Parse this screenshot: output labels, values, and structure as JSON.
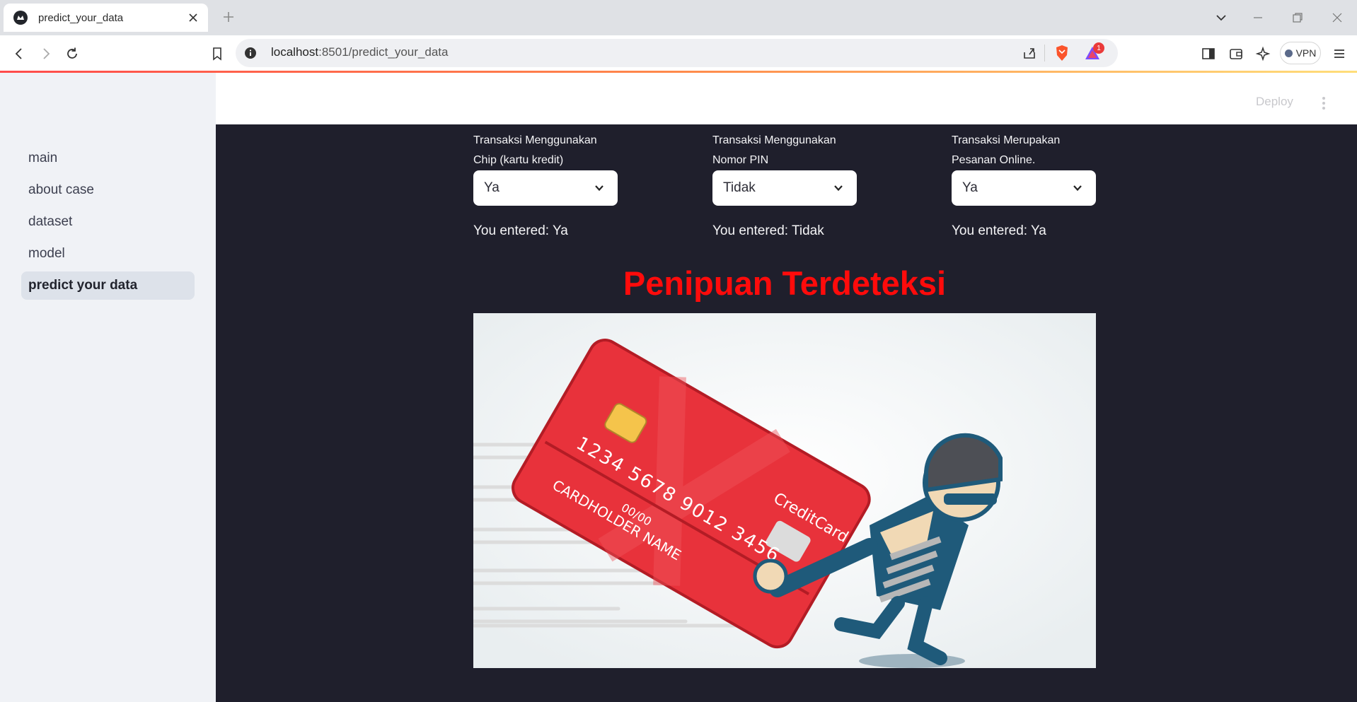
{
  "browser": {
    "tab_title": "predict_your_data",
    "url_host": "localhost",
    "url_rest": ":8501/predict_your_data",
    "vpn_label": "VPN",
    "notification_count": "1"
  },
  "app": {
    "deploy_label": "Deploy",
    "sidebar": {
      "items": [
        {
          "label": "main",
          "active": false
        },
        {
          "label": "about case",
          "active": false
        },
        {
          "label": "dataset",
          "active": false
        },
        {
          "label": "model",
          "active": false
        },
        {
          "label": "predict your data",
          "active": true
        }
      ]
    },
    "fields": [
      {
        "label_line1": "Transaksi Menggunakan",
        "label_line2": "Chip (kartu kredit)",
        "value": "Ya",
        "entered": "You entered: Ya"
      },
      {
        "label_line1": "Transaksi Menggunakan",
        "label_line2": "Nomor PIN",
        "value": "Tidak",
        "entered": "You entered: Tidak"
      },
      {
        "label_line1": "Transaksi Merupakan",
        "label_line2": "Pesanan Online.",
        "value": "Ya",
        "entered": "You entered: Ya"
      }
    ],
    "result_title": "Penipuan Terdeteksi",
    "result_color": "#ff0b0b",
    "illustration": {
      "card_number": [
        "1234",
        "5678",
        "9012",
        "3456"
      ],
      "card_brand": "CreditCard",
      "card_expiry": "00/00",
      "card_holder": "CARDHOLDER NAME"
    }
  }
}
